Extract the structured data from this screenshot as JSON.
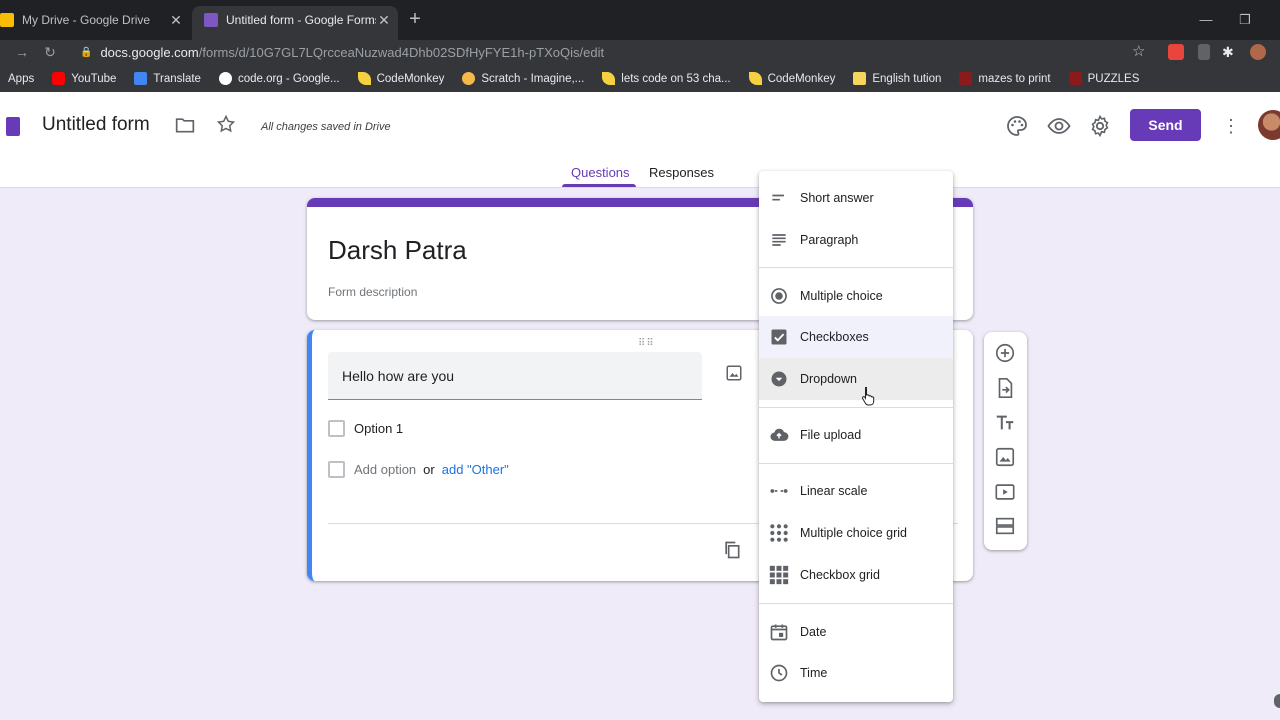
{
  "browser": {
    "tabs": [
      {
        "title": "My Drive - Google Drive",
        "active": false,
        "favicon_color": "#fbbc04"
      },
      {
        "title": "Untitled form - Google Forms",
        "active": true,
        "favicon_color": "#7e57c2"
      }
    ],
    "url_host": "docs.google.com",
    "url_path": "/forms/d/10G7GL7LQrcceaNuzwad4Dhb02SDfHyFYE1h-pTXoQis/edit",
    "bookmarks": [
      {
        "label": "Apps",
        "icon": "apps-grid-icon",
        "color": ""
      },
      {
        "label": "YouTube",
        "icon": "youtube-icon",
        "color": "#ff0000"
      },
      {
        "label": "Translate",
        "icon": "translate-icon",
        "color": "#4285f4"
      },
      {
        "label": "code.org - Google...",
        "icon": "google-icon",
        "color": "#ffffff"
      },
      {
        "label": "CodeMonkey",
        "icon": "banana-icon",
        "color": "#f5d142"
      },
      {
        "label": "Scratch - Imagine,...",
        "icon": "scratch-icon",
        "color": "#f5b94a"
      },
      {
        "label": "lets code on 53 cha...",
        "icon": "banana-icon",
        "color": "#f5d142"
      },
      {
        "label": "CodeMonkey",
        "icon": "banana-icon",
        "color": "#f5d142"
      },
      {
        "label": "English tution",
        "icon": "folder-icon",
        "color": "#f6d55c"
      },
      {
        "label": "mazes to print",
        "icon": "puzzle-icon",
        "color": "#8b1a1a"
      },
      {
        "label": "PUZZLES",
        "icon": "puzzle-icon",
        "color": "#8b1a1a"
      }
    ]
  },
  "header": {
    "title": "Untitled form",
    "saved": "All changes saved in Drive",
    "send": "Send",
    "tabs": {
      "questions": "Questions",
      "responses": "Responses"
    }
  },
  "form": {
    "heading": "Darsh Patra",
    "description": "Form description",
    "question": "Hello how are you",
    "option1": "Option 1",
    "add_option": "Add option",
    "or": "or",
    "add_other": "add \"Other\""
  },
  "menu": {
    "items": [
      {
        "label": "Short answer",
        "icon": "short-answer-icon"
      },
      {
        "label": "Paragraph",
        "icon": "paragraph-icon"
      },
      {
        "label": "Multiple choice",
        "icon": "radio-button-icon"
      },
      {
        "label": "Checkboxes",
        "icon": "checkbox-icon"
      },
      {
        "label": "Dropdown",
        "icon": "dropdown-icon"
      },
      {
        "label": "File upload",
        "icon": "cloud-upload-icon"
      },
      {
        "label": "Linear scale",
        "icon": "linear-scale-icon"
      },
      {
        "label": "Multiple choice grid",
        "icon": "dot-grid-icon"
      },
      {
        "label": "Checkbox grid",
        "icon": "square-grid-icon"
      },
      {
        "label": "Date",
        "icon": "calendar-icon"
      },
      {
        "label": "Time",
        "icon": "clock-icon"
      }
    ],
    "selected": "Checkboxes",
    "hovered": "Dropdown"
  },
  "colors": {
    "accent": "#673ab7",
    "background": "#f0ebf8",
    "link": "#1a73e8",
    "question_border": "#4285f4"
  }
}
